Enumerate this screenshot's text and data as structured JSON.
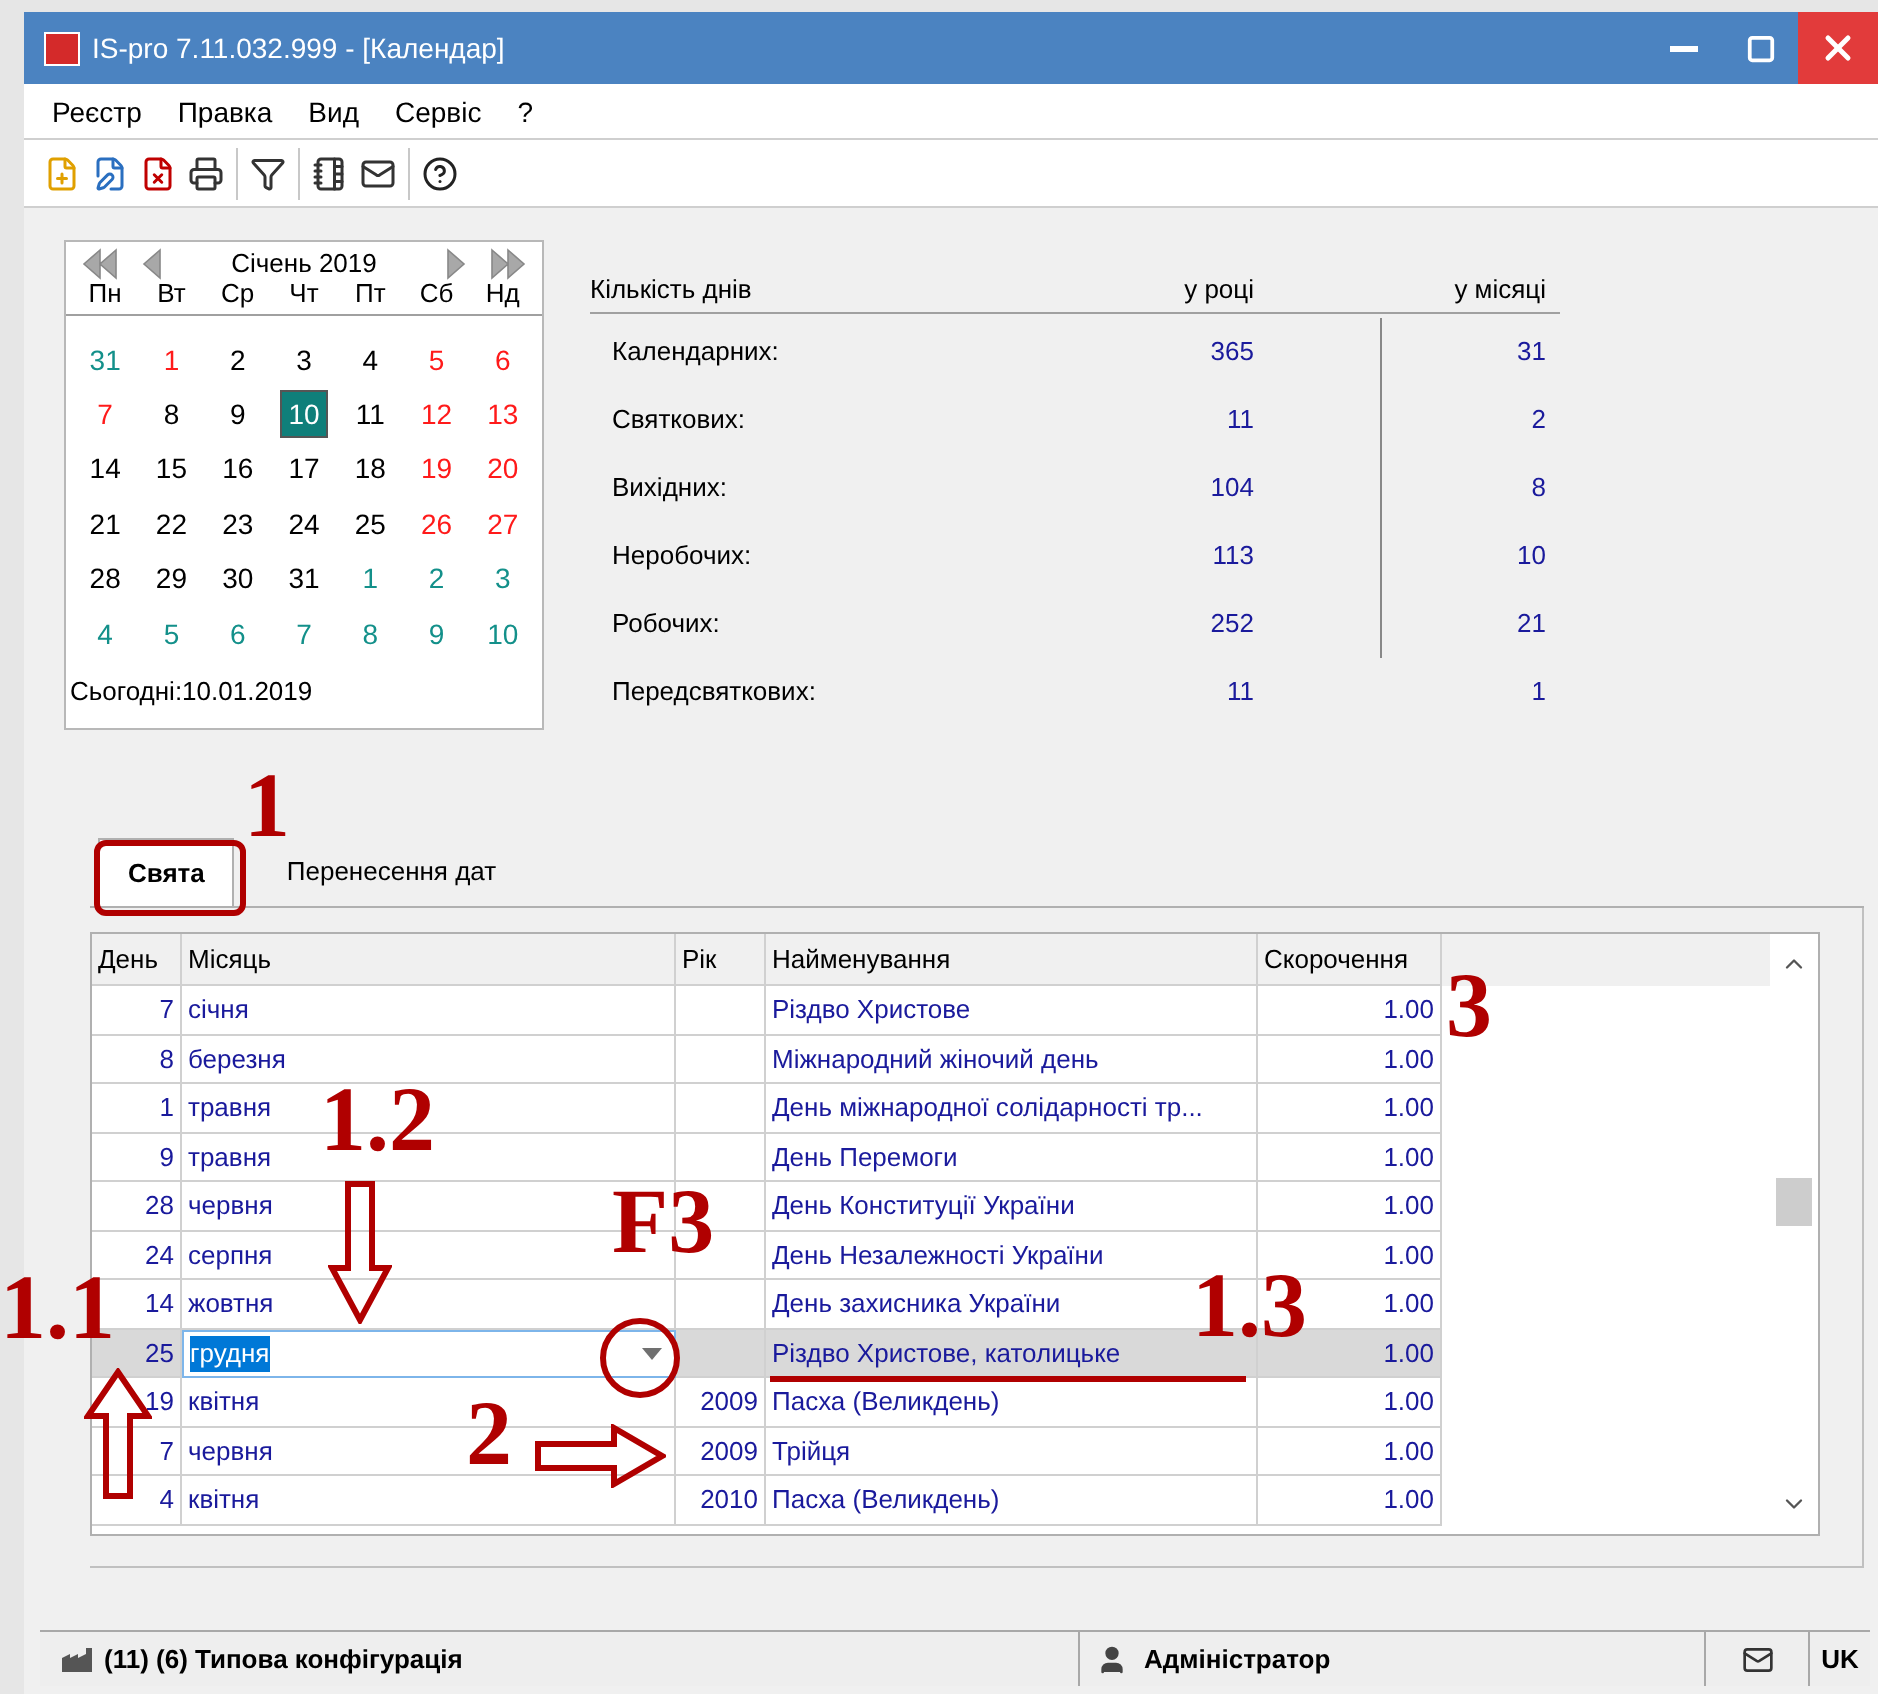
{
  "window": {
    "title": "IS-pro 7.11.032.999 - [Календар]"
  },
  "menu": [
    "Реєстр",
    "Правка",
    "Вид",
    "Сервіс",
    "?"
  ],
  "calendar": {
    "month": "Січень 2019",
    "weekdays": [
      "Пн",
      "Вт",
      "Ср",
      "Чт",
      "Пт",
      "Сб",
      "Нд"
    ],
    "weeks": [
      [
        {
          "day": "31",
          "kind": "other",
          "selected": false
        },
        {
          "day": "1",
          "kind": "off",
          "selected": false
        },
        {
          "day": "2",
          "kind": "work",
          "selected": false
        },
        {
          "day": "3",
          "kind": "work",
          "selected": false
        },
        {
          "day": "4",
          "kind": "work",
          "selected": false
        },
        {
          "day": "5",
          "kind": "off",
          "selected": false
        },
        {
          "day": "6",
          "kind": "off",
          "selected": false
        }
      ],
      [
        {
          "day": "7",
          "kind": "off",
          "selected": false
        },
        {
          "day": "8",
          "kind": "work",
          "selected": false
        },
        {
          "day": "9",
          "kind": "work",
          "selected": false
        },
        {
          "day": "10",
          "selected": true
        },
        {
          "day": "11",
          "kind": "work",
          "selected": false
        },
        {
          "day": "12",
          "kind": "off",
          "selected": false
        },
        {
          "day": "13",
          "kind": "off",
          "selected": false
        }
      ],
      [
        {
          "day": "14",
          "kind": "work",
          "selected": false
        },
        {
          "day": "15",
          "kind": "work",
          "selected": false
        },
        {
          "day": "16",
          "kind": "work",
          "selected": false
        },
        {
          "day": "17",
          "kind": "work",
          "selected": false
        },
        {
          "day": "18",
          "kind": "work",
          "selected": false
        },
        {
          "day": "19",
          "kind": "off",
          "selected": false
        },
        {
          "day": "20",
          "kind": "off",
          "selected": false
        }
      ],
      [
        {
          "day": "21",
          "kind": "work",
          "selected": false
        },
        {
          "day": "22",
          "kind": "work",
          "selected": false
        },
        {
          "day": "23",
          "kind": "work",
          "selected": false
        },
        {
          "day": "24",
          "kind": "work",
          "selected": false
        },
        {
          "day": "25",
          "kind": "work",
          "selected": false
        },
        {
          "day": "26",
          "kind": "off",
          "selected": false
        },
        {
          "day": "27",
          "kind": "off",
          "selected": false
        }
      ],
      [
        {
          "day": "28",
          "kind": "work",
          "selected": false
        },
        {
          "day": "29",
          "kind": "work",
          "selected": false
        },
        {
          "day": "30",
          "kind": "work",
          "selected": false
        },
        {
          "day": "31",
          "kind": "work",
          "selected": false
        },
        {
          "day": "1",
          "kind": "other",
          "selected": false
        },
        {
          "day": "2",
          "kind": "other",
          "selected": false
        },
        {
          "day": "3",
          "kind": "other",
          "selected": false
        }
      ],
      [
        {
          "day": "4",
          "kind": "other",
          "selected": false
        },
        {
          "day": "5",
          "kind": "other",
          "selected": false
        },
        {
          "day": "6",
          "kind": "other",
          "selected": false
        },
        {
          "day": "7",
          "kind": "other",
          "selected": false
        },
        {
          "day": "8",
          "kind": "other",
          "selected": false
        },
        {
          "day": "9",
          "kind": "other",
          "selected": false
        },
        {
          "day": "10",
          "kind": "other",
          "selected": false
        }
      ]
    ],
    "today": "Сьогодні:10.01.2019"
  },
  "day_counts": {
    "heading": "Кількість днів",
    "year_heading": "у році",
    "month_heading": "у місяці",
    "rows": [
      {
        "label": "Календарних:",
        "year": "365",
        "month": "31"
      },
      {
        "label": "Святкових:",
        "year": "11",
        "month": "2"
      },
      {
        "label": "Вихідних:",
        "year": "104",
        "month": "8"
      },
      {
        "label": "Неробочих:",
        "year": "113",
        "month": "10"
      },
      {
        "label": "Робочих:",
        "year": "252",
        "month": "21"
      },
      {
        "label": "Передсвяткових:",
        "year": "11",
        "month": "1"
      }
    ]
  },
  "tabs": [
    {
      "label": "Свята",
      "selected": true
    },
    {
      "label": "Перенесення дат",
      "selected": false
    }
  ],
  "table": {
    "columns": [
      "День",
      "Місяць",
      "Рік",
      "Найменування",
      "Скорочення"
    ],
    "rows": [
      {
        "day": "7",
        "month": "січня",
        "name": "Різдво Христове",
        "reduction": "1.00",
        "selected": false
      },
      {
        "day": "8",
        "month": "березня",
        "name": "Міжнародний жіночий день",
        "reduction": "1.00",
        "selected": false
      },
      {
        "day": "1",
        "month": "травня",
        "name": "День міжнародної солідарності тр...",
        "reduction": "1.00",
        "selected": false
      },
      {
        "day": "9",
        "month": "травня",
        "name": "День Перемоги",
        "reduction": "1.00",
        "selected": false
      },
      {
        "day": "28",
        "month": "червня",
        "name": "День Конституції України",
        "reduction": "1.00",
        "selected": false
      },
      {
        "day": "24",
        "month": "серпня",
        "name": "День Незалежності України",
        "reduction": "1.00",
        "selected": false
      },
      {
        "day": "14",
        "month": "жовтня",
        "name": "День захисника України",
        "reduction": "1.00",
        "selected": false
      },
      {
        "day": "25",
        "month": "грудня",
        "name": "Різдво Христове, католицьке",
        "reduction": "1.00",
        "selected": true
      },
      {
        "day": "19",
        "month": "квітня",
        "year": "2009",
        "name": "Пасха (Великдень)",
        "reduction": "1.00",
        "selected": false
      },
      {
        "day": "7",
        "month": "червня",
        "year": "2009",
        "name": "Трійця",
        "reduction": "1.00",
        "selected": false
      },
      {
        "day": "4",
        "month": "квітня",
        "year": "2010",
        "name": "Пасха (Великдень)",
        "reduction": "1.00",
        "selected": false
      }
    ]
  },
  "status_bar": {
    "config": "(11) (6) Типова конфігурація",
    "user": "Адміністратор",
    "language": "UK"
  },
  "annotations": [
    {
      "kind": "label",
      "text": "1"
    },
    {
      "kind": "frame"
    },
    {
      "kind": "label",
      "text": "1.2"
    },
    {
      "kind": "down-arrow"
    },
    {
      "kind": "label",
      "text": "F3"
    },
    {
      "kind": "circle"
    },
    {
      "kind": "label",
      "text": "1.1"
    },
    {
      "kind": "up-arrow"
    },
    {
      "kind": "label",
      "text": "1.3"
    },
    {
      "kind": "underline"
    },
    {
      "kind": "label",
      "text": "2"
    },
    {
      "kind": "right-arrow"
    },
    {
      "kind": "label",
      "text": "3"
    }
  ]
}
